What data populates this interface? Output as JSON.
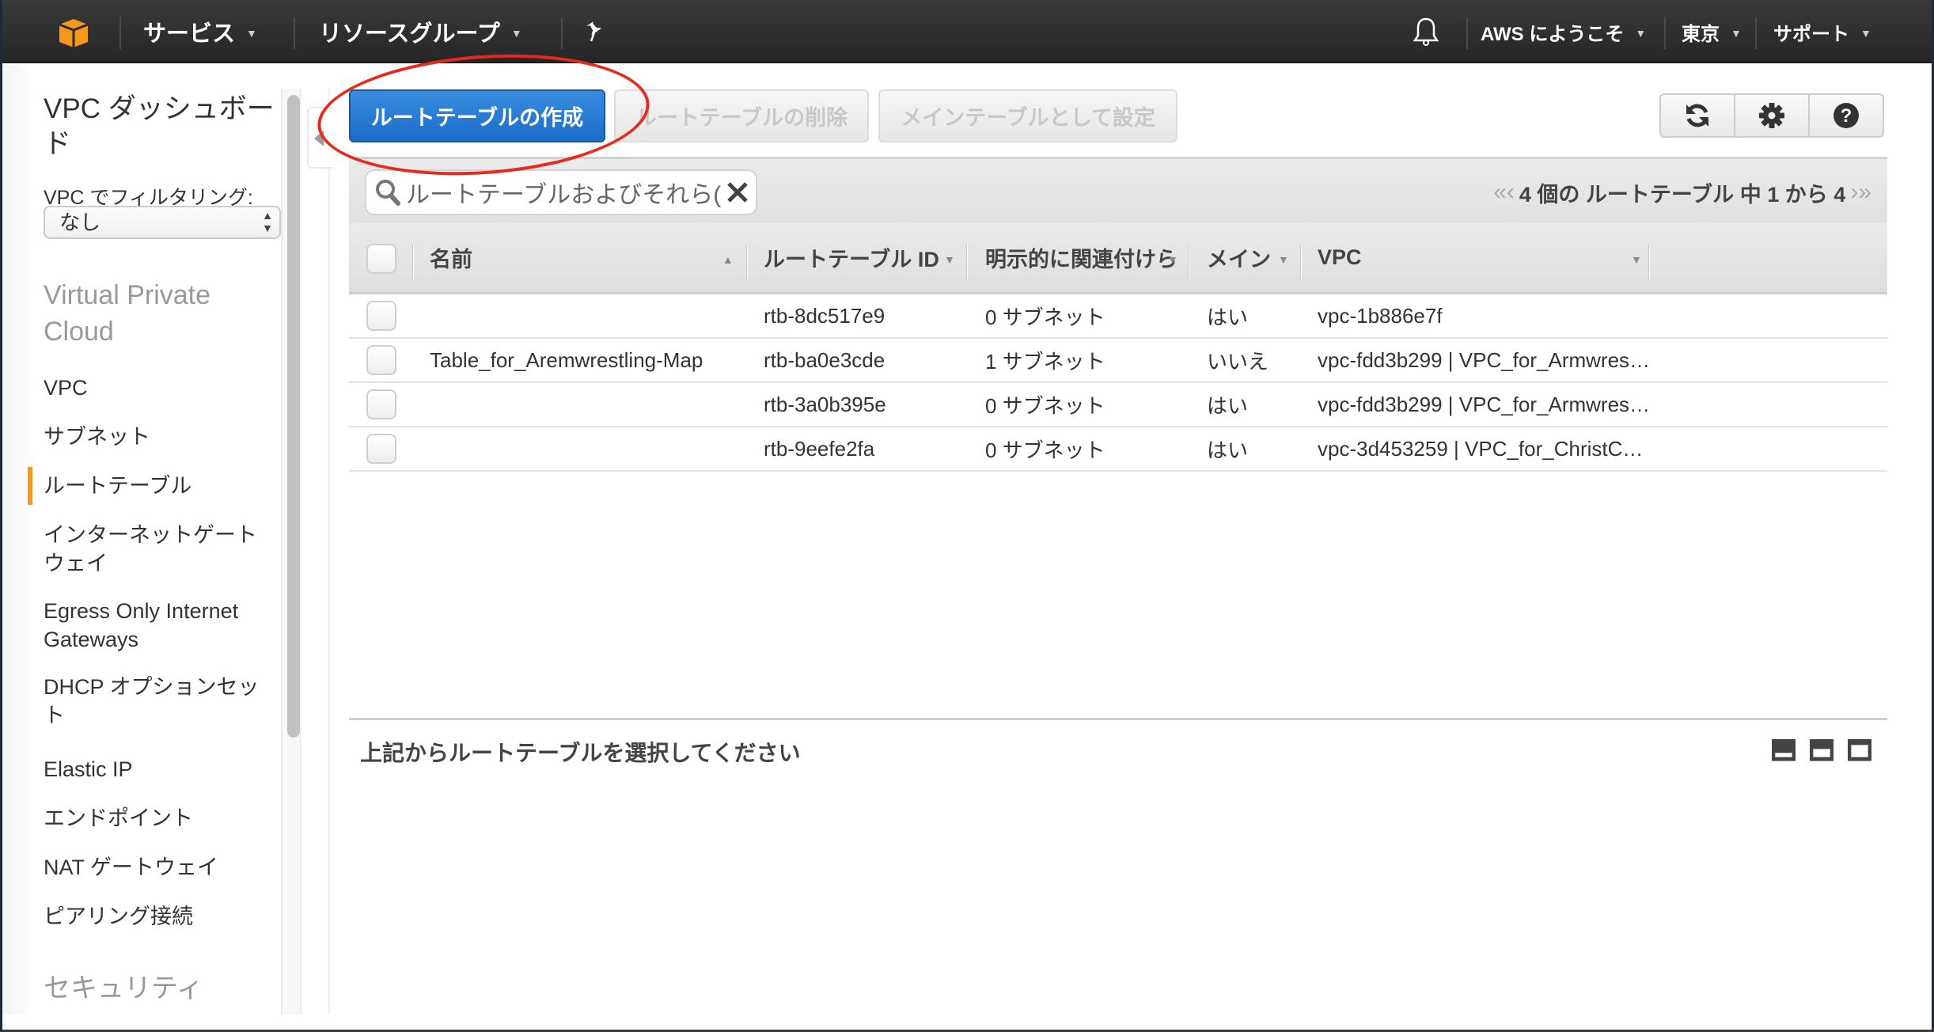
{
  "topbar": {
    "logo_icon": "aws-cube-icon",
    "services_label": "サービス",
    "resource_groups_label": "リソースグループ",
    "pin_icon": "pushpin-icon",
    "bell_icon": "bell-icon",
    "account_label": "AWS にようこそ",
    "region_label": "東京",
    "support_label": "サポート",
    "brand_color": "#f7981d"
  },
  "sidebar": {
    "dashboard_title": "VPC ダッシュボード",
    "filter_label": "VPC でフィルタリング:",
    "filter_selected": "なし",
    "sections": [
      {
        "title": "Virtual Private Cloud",
        "items": [
          {
            "label": "VPC",
            "active": false
          },
          {
            "label": "サブネット",
            "active": false
          },
          {
            "label": "ルートテーブル",
            "active": true
          },
          {
            "label": "インターネットゲートウェイ",
            "active": false
          },
          {
            "label": "Egress Only Internet Gateways",
            "active": false
          },
          {
            "label": "DHCP オプションセット",
            "active": false
          },
          {
            "label": "Elastic IP",
            "active": false
          },
          {
            "label": "エンドポイント",
            "active": false
          },
          {
            "label": "NAT ゲートウェイ",
            "active": false
          },
          {
            "label": "ピアリング接続",
            "active": false
          }
        ]
      },
      {
        "title": "セキュリティ",
        "items": []
      }
    ],
    "active_color": "#f7981d"
  },
  "toolbar": {
    "create_label": "ルートテーブルの作成",
    "delete_label": "ルートテーブルの削除",
    "set_main_label": "メインテーブルとして設定",
    "refresh_icon": "refresh-icon",
    "settings_icon": "gear-icon",
    "help_icon": "help-circle-icon",
    "primary_color": "#1f72cf"
  },
  "filter": {
    "search_placeholder": "ルートテーブルおよびそれら(",
    "clear_icon": "close-icon",
    "pagination_text": "4 個の ルートテーブル 中 1 から 4",
    "first_icon": "«",
    "prev_icon": "‹",
    "next_icon": "›",
    "last_icon": "»"
  },
  "table": {
    "columns": [
      {
        "label": "名前",
        "sort": "asc"
      },
      {
        "label": "ルートテーブル ID",
        "sort": "menu"
      },
      {
        "label": "明示的に関連付けら",
        "sort": "menu"
      },
      {
        "label": "メイン",
        "sort": "menu"
      },
      {
        "label": "VPC",
        "sort": "menu"
      }
    ],
    "rows": [
      {
        "name": "",
        "id": "rtb-8dc517e9",
        "assoc": "0 サブネット",
        "main": "はい",
        "vpc": "vpc-1b886e7f"
      },
      {
        "name": "Table_for_Aremwrestling-Map",
        "id": "rtb-ba0e3cde",
        "assoc": "1 サブネット",
        "main": "いいえ",
        "vpc": "vpc-fdd3b299 | VPC_for_Armwres…"
      },
      {
        "name": "",
        "id": "rtb-3a0b395e",
        "assoc": "0 サブネット",
        "main": "はい",
        "vpc": "vpc-fdd3b299 | VPC_for_Armwres…"
      },
      {
        "name": "",
        "id": "rtb-9eefe2fa",
        "assoc": "0 サブネット",
        "main": "はい",
        "vpc": "vpc-3d453259 | VPC_for_ChristC…"
      }
    ]
  },
  "detail": {
    "message": "上記からルートテーブルを選択してください",
    "layout_icons": [
      "panel-small-icon",
      "panel-medium-icon",
      "panel-large-icon"
    ]
  },
  "annotation": {
    "color": "#e8291c",
    "target": "create-route-table-button"
  }
}
